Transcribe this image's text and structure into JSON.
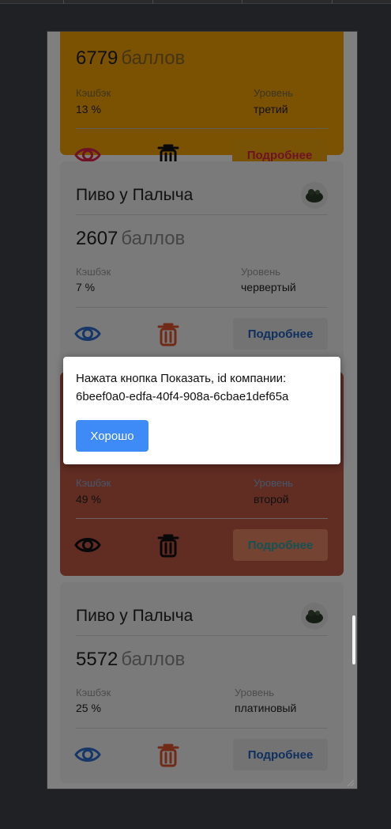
{
  "cards": [
    {
      "points_number": "6779",
      "points_label": "баллов",
      "cashback_label": "Кэшбэк",
      "cashback_value": "13 %",
      "level_label": "Уровень",
      "level_value": "третий",
      "more_label": "Подробнее"
    },
    {
      "title": "Пиво у Палыча",
      "points_number": "2607",
      "points_label": "баллов",
      "cashback_label": "Кэшбэк",
      "cashback_value": "7 %",
      "level_label": "Уровень",
      "level_value": "червертый",
      "more_label": "Подробнее"
    },
    {
      "cashback_label": "Кэшбэк",
      "cashback_value": "49 %",
      "level_label": "Уровень",
      "level_value": "второй",
      "more_label": "Подробнее"
    },
    {
      "title": "Пиво у Палыча",
      "points_number": "5572",
      "points_label": "баллов",
      "cashback_label": "Кэшбэк",
      "cashback_value": "25 %",
      "level_label": "Уровень",
      "level_value": "платиновый",
      "more_label": "Подробнее"
    }
  ],
  "dialog": {
    "message": "Нажата кнопка Показать, id компании: 6beef0a0-edfa-40f4-908a-6cbae1def65a",
    "ok_label": "Хорошо"
  },
  "colors": {
    "yellow_card": "#f4a404",
    "grey_card": "#f5f5f5",
    "red_card": "#c25842",
    "accent_blue": "#3e8af7",
    "eye_blue": "#2f6fd1",
    "delete_red": "#e0552b",
    "more_pink": "#e0254a",
    "more_teal": "#29a4a8",
    "more_blue": "#1f5fbf"
  },
  "icons": {
    "view": "eye-icon",
    "delete": "trash-icon",
    "logo": "beer-logo-icon"
  }
}
